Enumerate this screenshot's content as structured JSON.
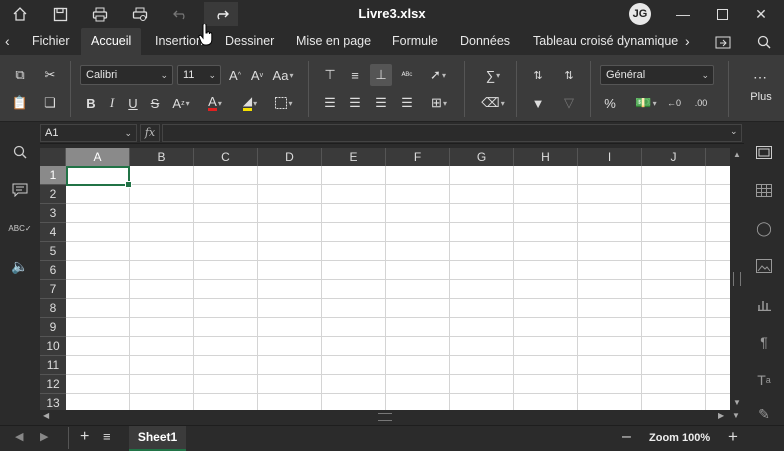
{
  "window": {
    "title": "Livre3.xlsx",
    "user_initials": "JG"
  },
  "titlebar_icons": [
    "home-icon",
    "save-icon",
    "print-icon",
    "print-preview-icon",
    "undo-icon",
    "redo-icon"
  ],
  "tabs": [
    {
      "label": "Fichier",
      "active": false
    },
    {
      "label": "Accueil",
      "active": true
    },
    {
      "label": "Insertion",
      "active": false
    },
    {
      "label": "Dessiner",
      "active": false
    },
    {
      "label": "Mise en page",
      "active": false
    },
    {
      "label": "Formule",
      "active": false
    },
    {
      "label": "Données",
      "active": false
    },
    {
      "label": "Tableau croisé dynamique",
      "active": false
    }
  ],
  "ribbon": {
    "font_name": "Calibri",
    "font_size": "11",
    "number_format": "Général",
    "more_label": "Plus",
    "accent_font_color": "#e02020",
    "accent_fill_color": "#f5e000"
  },
  "formula_bar": {
    "name_box": "A1",
    "fx_label": "fx",
    "formula": ""
  },
  "grid": {
    "columns": [
      "A",
      "B",
      "C",
      "D",
      "E",
      "F",
      "G",
      "H",
      "I",
      "J"
    ],
    "rows": [
      "1",
      "2",
      "3",
      "4",
      "5",
      "6",
      "7",
      "8",
      "9",
      "10",
      "11",
      "12",
      "13"
    ],
    "active_cell": "A1"
  },
  "status": {
    "sheet_name": "Sheet1",
    "zoom": "Zoom 100%"
  }
}
